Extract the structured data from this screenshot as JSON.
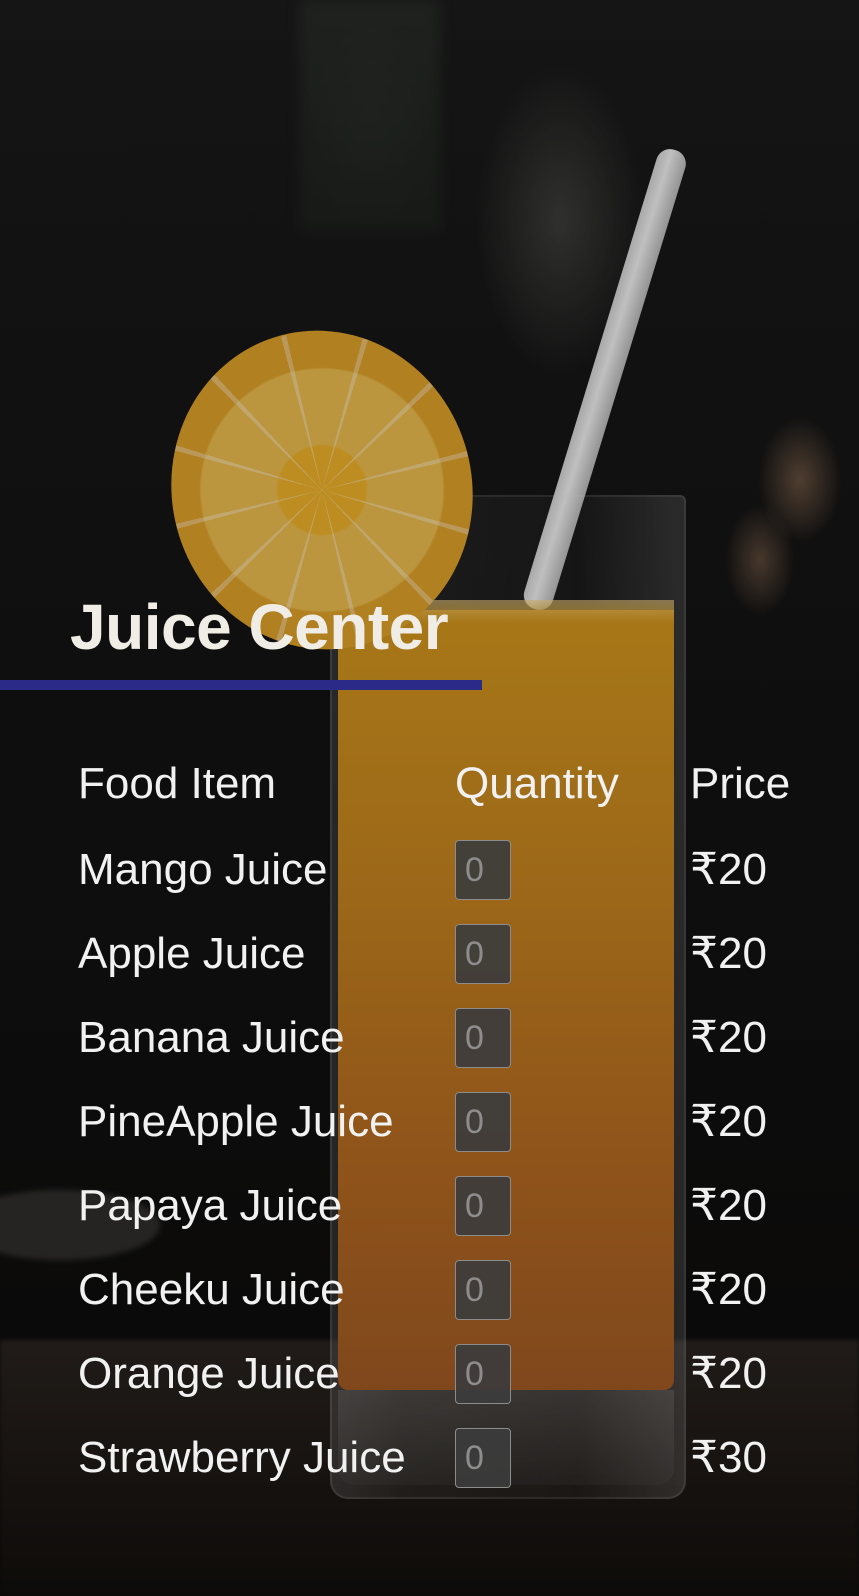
{
  "title": "Juice Center",
  "headers": {
    "item": "Food Item",
    "quantity": "Quantity",
    "price": "Price"
  },
  "items": [
    {
      "name": "Mango Juice",
      "quantity": "0",
      "price": "₹20"
    },
    {
      "name": "Apple Juice",
      "quantity": "0",
      "price": "₹20"
    },
    {
      "name": "Banana Juice",
      "quantity": "0",
      "price": "₹20"
    },
    {
      "name": "PineApple Juice",
      "quantity": "0",
      "price": "₹20"
    },
    {
      "name": "Papaya Juice",
      "quantity": "0",
      "price": "₹20"
    },
    {
      "name": "Cheeku Juice",
      "quantity": "0",
      "price": "₹20"
    },
    {
      "name": "Orange Juice",
      "quantity": "0",
      "price": "₹20"
    },
    {
      "name": "Strawberry Juice",
      "quantity": "0",
      "price": "₹30"
    }
  ],
  "colors": {
    "accent_line": "#2c2a88",
    "text": "#f1f1f1"
  }
}
